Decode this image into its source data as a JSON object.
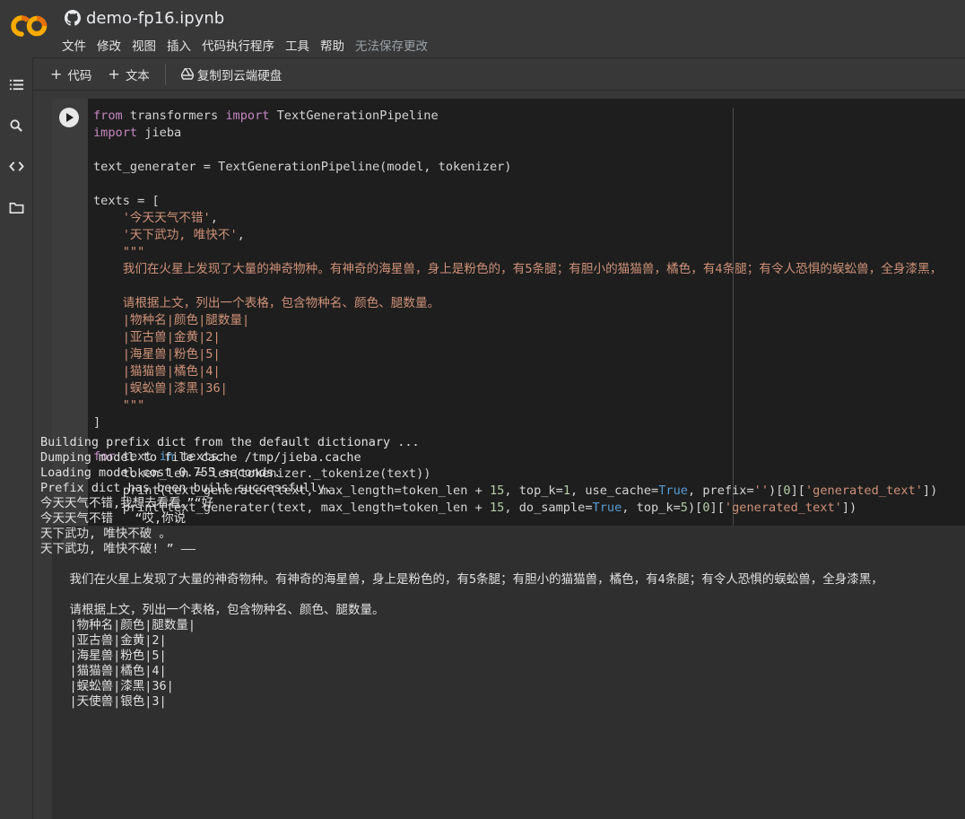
{
  "app": {
    "notebook_title": "demo-fp16.ipynb",
    "brand_colors": {
      "logo_orange": "#f9ab00",
      "logo_dark": "#e8710a"
    }
  },
  "menu": {
    "items": [
      "文件",
      "修改",
      "视图",
      "插入",
      "代码执行程序",
      "工具",
      "帮助"
    ],
    "status": "无法保存更改"
  },
  "toolbar": {
    "add_code": "代码",
    "add_text": "文本",
    "copy_drive": "复制到云端硬盘"
  },
  "rail": {
    "icons": [
      "table-of-contents-icon",
      "search-icon",
      "code-snippets-icon",
      "files-icon"
    ]
  },
  "code_cell": {
    "lines": [
      [
        {
          "t": "from",
          "c": "kw"
        },
        {
          "t": " transformers "
        },
        {
          "t": "import",
          "c": "kw"
        },
        {
          "t": " TextGenerationPipeline"
        }
      ],
      [
        {
          "t": "import",
          "c": "kw"
        },
        {
          "t": " jieba"
        }
      ],
      [],
      [
        {
          "t": "text_generater = TextGenerationPipeline(model, tokenizer)"
        }
      ],
      [],
      [
        {
          "t": "texts = ["
        }
      ],
      [
        {
          "t": "    "
        },
        {
          "t": "'今天天气不错'",
          "c": "str"
        },
        {
          "t": ","
        }
      ],
      [
        {
          "t": "    "
        },
        {
          "t": "'天下武功, 唯快不'",
          "c": "str"
        },
        {
          "t": ","
        }
      ],
      [
        {
          "t": "    "
        },
        {
          "t": "\"\"\"",
          "c": "str"
        }
      ],
      [
        {
          "t": "    "
        },
        {
          "t": "我们在火星上发现了大量的神奇物种。有神奇的海星兽，身上是粉色的，有5条腿；有胆小的猫猫兽，橘色，有4条腿；有令人恐惧的蜈蚣兽，全身漆黑，",
          "c": "str"
        }
      ],
      [],
      [
        {
          "t": "    "
        },
        {
          "t": "请根据上文，列出一个表格，包含物种名、颜色、腿数量。",
          "c": "str"
        }
      ],
      [
        {
          "t": "    "
        },
        {
          "t": "|物种名|颜色|腿数量|",
          "c": "str"
        }
      ],
      [
        {
          "t": "    "
        },
        {
          "t": "|亚古兽|金黄|2|",
          "c": "str"
        }
      ],
      [
        {
          "t": "    "
        },
        {
          "t": "|海星兽|粉色|5|",
          "c": "str"
        }
      ],
      [
        {
          "t": "    "
        },
        {
          "t": "|猫猫兽|橘色|4|",
          "c": "str"
        }
      ],
      [
        {
          "t": "    "
        },
        {
          "t": "|蜈蚣兽|漆黑|36|",
          "c": "str"
        }
      ],
      [
        {
          "t": "    "
        },
        {
          "t": "\"\"\"",
          "c": "str"
        }
      ],
      [
        {
          "t": "]"
        }
      ],
      [],
      [
        {
          "t": "for",
          "c": "kw"
        },
        {
          "t": " text "
        },
        {
          "t": "in",
          "c": "kw2"
        },
        {
          "t": " texts:"
        }
      ],
      [
        {
          "t": "    token_len = len(tokenizer._tokenize(text))"
        }
      ],
      [
        {
          "t": "    print(text_generater(text, max_length=token_len + "
        },
        {
          "t": "15",
          "c": "num"
        },
        {
          "t": ", top_k="
        },
        {
          "t": "1",
          "c": "num"
        },
        {
          "t": ", use_cache="
        },
        {
          "t": "True",
          "c": "bool"
        },
        {
          "t": ", prefix="
        },
        {
          "t": "''",
          "c": "str"
        },
        {
          "t": ")["
        },
        {
          "t": "0",
          "c": "num"
        },
        {
          "t": "]["
        },
        {
          "t": "'generated_text'",
          "c": "str"
        },
        {
          "t": "])"
        }
      ],
      [
        {
          "t": "    print(text_generater(text, max_length=token_len + "
        },
        {
          "t": "15",
          "c": "num"
        },
        {
          "t": ", do_sample="
        },
        {
          "t": "True",
          "c": "bool"
        },
        {
          "t": ", top_k="
        },
        {
          "t": "5",
          "c": "num"
        },
        {
          "t": ")["
        },
        {
          "t": "0",
          "c": "num"
        },
        {
          "t": "]["
        },
        {
          "t": "'generated_text'",
          "c": "str"
        },
        {
          "t": "])"
        }
      ]
    ]
  },
  "output_cell": {
    "lines": [
      "Building prefix dict from the default dictionary ...",
      "Dumping model to file cache /tmp/jieba.cache",
      "Loading model cost 0.755 seconds.",
      "Prefix dict has been built successfully.",
      "今天天气不错,我想去看看。”“好",
      "今天天气不错   “哎,你说",
      "天下武功, 唯快不破 。",
      "天下武功, 唯快不破! ” ——",
      "",
      "    我们在火星上发现了大量的神奇物种。有神奇的海星兽，身上是粉色的，有5条腿；有胆小的猫猫兽，橘色，有4条腿；有令人恐惧的蜈蚣兽，全身漆黑，",
      "",
      "    请根据上文，列出一个表格，包含物种名、颜色、腿数量。",
      "    |物种名|颜色|腿数量|",
      "    |亚古兽|金黄|2|",
      "    |海星兽|粉色|5|",
      "    |猫猫兽|橘色|4|",
      "    |蜈蚣兽|漆黑|36|",
      "    |天使兽|银色|3|"
    ]
  }
}
